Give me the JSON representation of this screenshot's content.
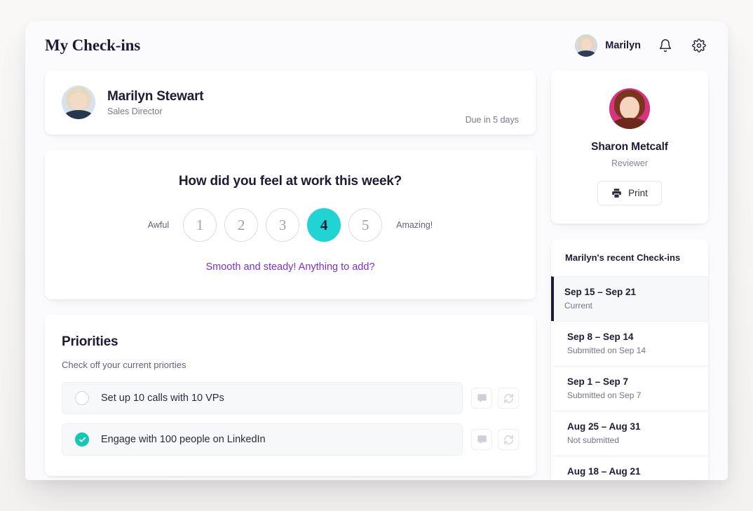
{
  "header": {
    "title": "My Check-ins",
    "user_name": "Marilyn",
    "notifications_icon": "bell-icon",
    "settings_icon": "gear-icon"
  },
  "profile": {
    "name": "Marilyn Stewart",
    "role": "Sales Director",
    "due": "Due in 5 days"
  },
  "mood": {
    "question": "How did you feel at work this week?",
    "low_label": "Awful",
    "high_label": "Amazing!",
    "options": [
      "1",
      "2",
      "3",
      "4",
      "5"
    ],
    "selected": "4",
    "prompt_link": "Smooth and steady! Anything to add?",
    "selected_color": "#22d3d3",
    "link_color": "#7b2fd4"
  },
  "priorities": {
    "title": "Priorities",
    "subtitle": "Check off your current priorties",
    "comment_icon": "comment-icon",
    "refresh_icon": "refresh-icon",
    "items": [
      {
        "label": "Set up 10 calls with 10 VPs",
        "done": false
      },
      {
        "label": "Engage with 100 people on LinkedIn",
        "done": true
      }
    ]
  },
  "reviewer": {
    "name": "Sharon Metcalf",
    "role": "Reviewer",
    "print_label": "Print",
    "print_icon": "printer-icon"
  },
  "recent": {
    "title": "Marilyn's recent Check-ins",
    "items": [
      {
        "range": "Sep 15 – Sep 21",
        "status": "Current",
        "active": true
      },
      {
        "range": "Sep 8 – Sep 14",
        "status": "Submitted on Sep 14",
        "active": false
      },
      {
        "range": "Sep 1 – Sep 7",
        "status": "Submitted on Sep 7",
        "active": false
      },
      {
        "range": "Aug 25 – Aug 31",
        "status": "Not submitted",
        "active": false
      },
      {
        "range": "Aug 18 – Aug 21",
        "status": "",
        "active": false
      }
    ]
  }
}
